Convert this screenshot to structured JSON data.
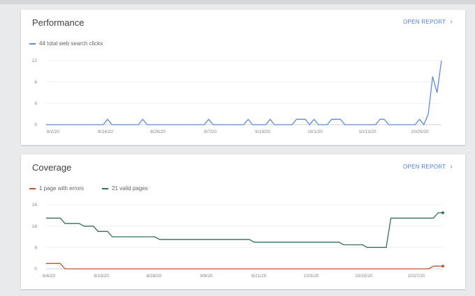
{
  "performance": {
    "title": "Performance",
    "open_report_label": "OPEN REPORT",
    "legend_label": "44 total web search clicks",
    "chart_data": {
      "type": "line",
      "title": "",
      "ylim": [
        0,
        12
      ],
      "yticks": [
        "12",
        "8",
        "4",
        "0"
      ],
      "xticks": [
        "8/2/20",
        "8/14/20",
        "8/26/20",
        "9/7/20",
        "9/19/20",
        "10/1/20",
        "10/13/20",
        "10/25/20"
      ],
      "series": [
        {
          "name": "44 total web search clicks",
          "color": "#5b8bd9",
          "points": [
            [
              0,
              0
            ],
            [
              13,
              0
            ],
            [
              14,
              1
            ],
            [
              15,
              0
            ],
            [
              21,
              0
            ],
            [
              22,
              1
            ],
            [
              23,
              0
            ],
            [
              36,
              0
            ],
            [
              37,
              1
            ],
            [
              38,
              0
            ],
            [
              45,
              0
            ],
            [
              46,
              1
            ],
            [
              47,
              0
            ],
            [
              50,
              0
            ],
            [
              51,
              1
            ],
            [
              52,
              0
            ],
            [
              56,
              0
            ],
            [
              57,
              1
            ],
            [
              59,
              1
            ],
            [
              60,
              0
            ],
            [
              61,
              1
            ],
            [
              62,
              0
            ],
            [
              64,
              0
            ],
            [
              65,
              1
            ],
            [
              67,
              1
            ],
            [
              68,
              0
            ],
            [
              75,
              0
            ],
            [
              76,
              1
            ],
            [
              77,
              1
            ],
            [
              78,
              0
            ],
            [
              84,
              0
            ],
            [
              85,
              1
            ],
            [
              86,
              0
            ],
            [
              87,
              2
            ],
            [
              88,
              9
            ],
            [
              89,
              6
            ],
            [
              90,
              12
            ]
          ]
        }
      ]
    }
  },
  "coverage": {
    "title": "Coverage",
    "open_report_label": "OPEN REPORT",
    "legend": [
      {
        "label": "1 page with errors",
        "color": "#c5522f"
      },
      {
        "label": "21 valid pages",
        "color": "#2f6e5c"
      }
    ],
    "chart_data": {
      "type": "line",
      "title": "",
      "ylim": [
        0,
        24
      ],
      "yticks": [
        "24",
        "16",
        "8",
        "0"
      ],
      "xticks": [
        "8/4/20",
        "8/16/20",
        "8/28/20",
        "9/9/20",
        "9/21/20",
        "10/3/20",
        "10/15/20",
        "10/27/20"
      ],
      "series": [
        {
          "name": "1 page with errors",
          "color": "#c5522f",
          "points": [
            [
              0,
              2
            ],
            [
              3,
              2
            ],
            [
              4,
              0
            ],
            [
              81,
              0
            ],
            [
              82,
              1
            ],
            [
              84,
              1
            ]
          ]
        },
        {
          "name": "21 valid pages",
          "color": "#2f6e5c",
          "points": [
            [
              0,
              19
            ],
            [
              3,
              19
            ],
            [
              4,
              17
            ],
            [
              7,
              17
            ],
            [
              8,
              16
            ],
            [
              10,
              16
            ],
            [
              11,
              14
            ],
            [
              13,
              14
            ],
            [
              14,
              12
            ],
            [
              23,
              12
            ],
            [
              24,
              11
            ],
            [
              43,
              11
            ],
            [
              44,
              10
            ],
            [
              62,
              10
            ],
            [
              63,
              9
            ],
            [
              67,
              9
            ],
            [
              68,
              8
            ],
            [
              72,
              8
            ],
            [
              73,
              19
            ],
            [
              82,
              19
            ],
            [
              83,
              21
            ],
            [
              84,
              21
            ]
          ]
        }
      ]
    }
  }
}
